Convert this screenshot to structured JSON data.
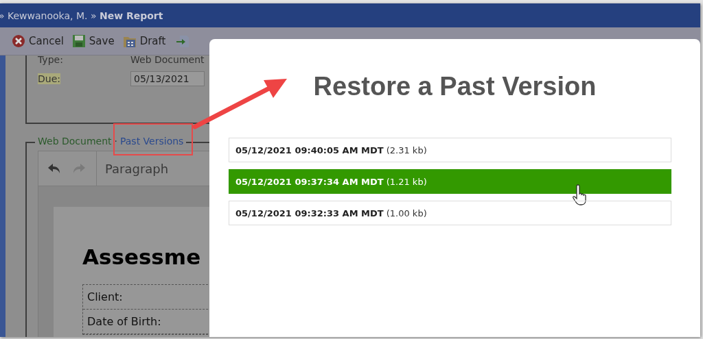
{
  "header": {
    "breadcrumb": "» Kewwanooka, M. » **New Report**"
  },
  "toolbar": [
    {
      "kind": "cancel",
      "label": "Cancel"
    },
    {
      "kind": "save",
      "label": "Save"
    },
    {
      "kind": "draft",
      "label": "Draft"
    },
    {
      "kind": "import"
    }
  ],
  "form": {
    "fields": [
      {
        "label": "Type:",
        "value": "Web Document",
        "kind": "text",
        "highlighted": false
      },
      {
        "label": "Due:",
        "value": "05/13/2021",
        "kind": "input",
        "highlighted": true
      }
    ]
  },
  "document_section": {
    "tabs": [
      {
        "label": "Web Document",
        "selected": true
      },
      {
        "label": "Past Versions",
        "selected": false
      }
    ],
    "separator": "·",
    "editor": {
      "format": "Paragraph",
      "heading": "Assessme",
      "table_rows": [
        "Client:",
        "Date of Birth:"
      ]
    }
  },
  "dialog": {
    "title": "Restore a Past Version",
    "versions": [
      {
        "timestamp": "05/12/2021 09:40:05 AM MDT",
        "size": "(2.31 kb)",
        "selected": false
      },
      {
        "timestamp": "05/12/2021 09:37:34 AM MDT",
        "size": "(1.21 kb)",
        "selected": true
      },
      {
        "timestamp": "05/12/2021 09:32:33 AM MDT",
        "size": "(1.00 kb)",
        "selected": false
      }
    ]
  }
}
